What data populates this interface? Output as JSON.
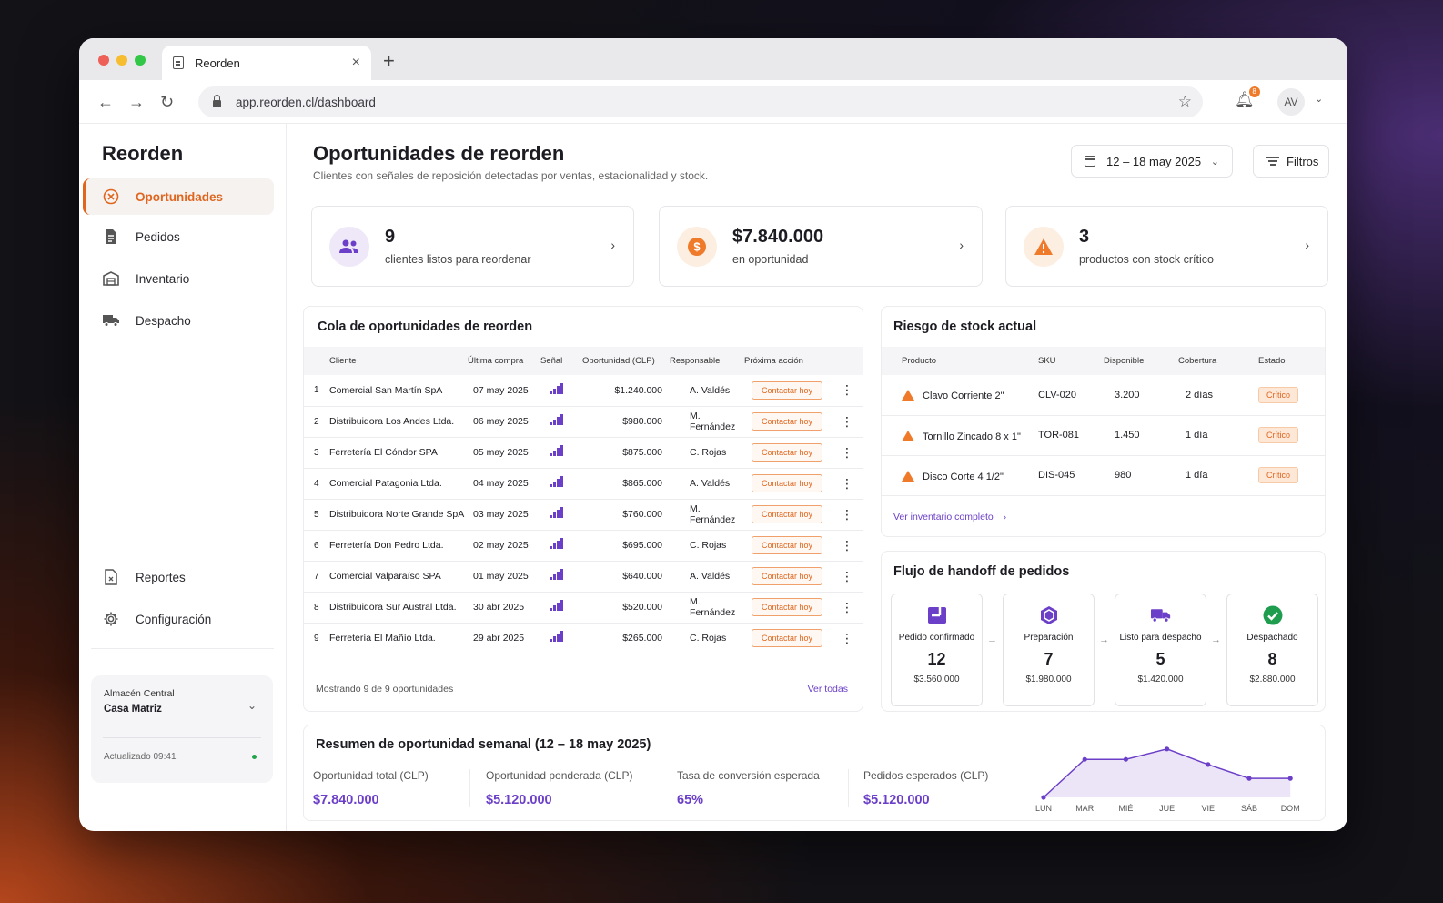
{
  "browser": {
    "tab_title": "Reorden",
    "tab_close": "×",
    "new_tab": "+",
    "url": "app.reorden.cl/dashboard",
    "notification_count": "8",
    "avatar": "AV",
    "traffic_lights": [
      "#ee5f57",
      "#f5bd2f",
      "#33c748"
    ]
  },
  "sidebar": {
    "brand": "Reorden",
    "items": [
      {
        "label": "Oportunidades",
        "icon": "target-icon",
        "active": true
      },
      {
        "label": "Pedidos",
        "icon": "document-icon",
        "active": false
      },
      {
        "label": "Inventario",
        "icon": "warehouse-icon",
        "active": false
      },
      {
        "label": "Despacho",
        "icon": "truck-icon",
        "active": false
      }
    ],
    "bottom_items": [
      {
        "label": "Reportes",
        "icon": "report-icon"
      },
      {
        "label": "Configuración",
        "icon": "gear-icon"
      }
    ],
    "warehouse": {
      "label": "Almacén Central",
      "name": "Casa Matriz",
      "updated": "Actualizado 09:41"
    }
  },
  "header": {
    "title": "Oportunidades de reorden",
    "subtitle": "Clientes con señales de reposición detectadas por ventas, estacionalidad y stock.",
    "date_range": "12 – 18 may 2025",
    "filters": "Filtros"
  },
  "kpis": [
    {
      "value": "9",
      "label": "clientes listos para reordenar",
      "icon": "users-icon",
      "color": "#6b3fc8"
    },
    {
      "value": "$7.840.000",
      "label": "en oportunidad",
      "icon": "dollar-icon",
      "color": "#ef7a2a"
    },
    {
      "value": "3",
      "label": "productos con stock crítico",
      "icon": "warning-icon",
      "color": "#ef7a2a"
    }
  ],
  "queue": {
    "title": "Cola de oportunidades de reorden",
    "columns": [
      "Cliente",
      "Última compra",
      "Señal",
      "Oportunidad (CLP)",
      "Responsable",
      "Próxima acción"
    ],
    "rows": [
      {
        "n": "1",
        "client": "Comercial San Martín SpA",
        "date": "07 may 2025",
        "amount": "$1.240.000",
        "owner": "A. Valdés",
        "action": "Contactar hoy"
      },
      {
        "n": "2",
        "client": "Distribuidora Los Andes Ltda.",
        "date": "06 may 2025",
        "amount": "$980.000",
        "owner": "M. Fernández",
        "action": "Contactar hoy"
      },
      {
        "n": "3",
        "client": "Ferretería El Cóndor SPA",
        "date": "05 may 2025",
        "amount": "$875.000",
        "owner": "C. Rojas",
        "action": "Contactar hoy"
      },
      {
        "n": "4",
        "client": "Comercial Patagonia Ltda.",
        "date": "04 may 2025",
        "amount": "$865.000",
        "owner": "A. Valdés",
        "action": "Contactar hoy"
      },
      {
        "n": "5",
        "client": "Distribuidora Norte Grande SpA",
        "date": "03 may 2025",
        "amount": "$760.000",
        "owner": "M. Fernández",
        "action": "Contactar hoy"
      },
      {
        "n": "6",
        "client": "Ferretería Don Pedro Ltda.",
        "date": "02 may 2025",
        "amount": "$695.000",
        "owner": "C. Rojas",
        "action": "Contactar hoy"
      },
      {
        "n": "7",
        "client": "Comercial Valparaíso SPA",
        "date": "01 may 2025",
        "amount": "$640.000",
        "owner": "A. Valdés",
        "action": "Contactar hoy"
      },
      {
        "n": "8",
        "client": "Distribuidora Sur Austral Ltda.",
        "date": "30 abr 2025",
        "amount": "$520.000",
        "owner": "M. Fernández",
        "action": "Contactar hoy"
      },
      {
        "n": "9",
        "client": "Ferretería El Mañío Ltda.",
        "date": "29 abr 2025",
        "amount": "$265.000",
        "owner": "C. Rojas",
        "action": "Contactar hoy"
      }
    ],
    "footer": "Mostrando 9 de 9 oportunidades",
    "view_all": "Ver todas"
  },
  "stock": {
    "title": "Riesgo de stock actual",
    "columns": [
      "Producto",
      "SKU",
      "Disponible",
      "Cobertura",
      "Estado"
    ],
    "rows": [
      {
        "product": "Clavo Corriente 2\"",
        "sku": "CLV-020",
        "available": "3.200",
        "coverage": "2 días",
        "status": "Crítico"
      },
      {
        "product": "Tornillo Zincado 8 x 1\"",
        "sku": "TOR-081",
        "available": "1.450",
        "coverage": "1 día",
        "status": "Crítico"
      },
      {
        "product": "Disco Corte 4 1/2\"",
        "sku": "DIS-045",
        "available": "980",
        "coverage": "1 día",
        "status": "Crítico"
      }
    ],
    "link": "Ver inventario completo"
  },
  "handoff": {
    "title": "Flujo de handoff de pedidos",
    "steps": [
      {
        "label": "Pedido confirmado",
        "count": "12",
        "amount": "$3.560.000",
        "icon": "confirmed-icon"
      },
      {
        "label": "Preparación",
        "count": "7",
        "amount": "$1.980.000",
        "icon": "box-icon"
      },
      {
        "label": "Listo para despacho",
        "count": "5",
        "amount": "$1.420.000",
        "icon": "truck-icon"
      },
      {
        "label": "Despachado",
        "count": "8",
        "amount": "$2.880.000",
        "icon": "check-circle-icon"
      }
    ]
  },
  "summary": {
    "title": "Resumen de oportunidad semanal (12 – 18 may 2025)",
    "metrics": [
      {
        "label": "Oportunidad total (CLP)",
        "value": "$7.840.000"
      },
      {
        "label": "Oportunidad ponderada (CLP)",
        "value": "$5.120.000"
      },
      {
        "label": "Tasa de conversión esperada",
        "value": "65%"
      },
      {
        "label": "Pedidos esperados (CLP)",
        "value": "$5.120.000"
      }
    ]
  },
  "chart_data": {
    "type": "area",
    "categories": [
      "LUN",
      "MAR",
      "MIÉ",
      "JUE",
      "VIE",
      "SÁB",
      "DOM"
    ],
    "values": [
      0,
      2.2,
      2.2,
      2.8,
      1.9,
      1.1,
      1.1
    ],
    "ylim": [
      0,
      3
    ],
    "grid": false,
    "color": "#6b3fc8"
  }
}
